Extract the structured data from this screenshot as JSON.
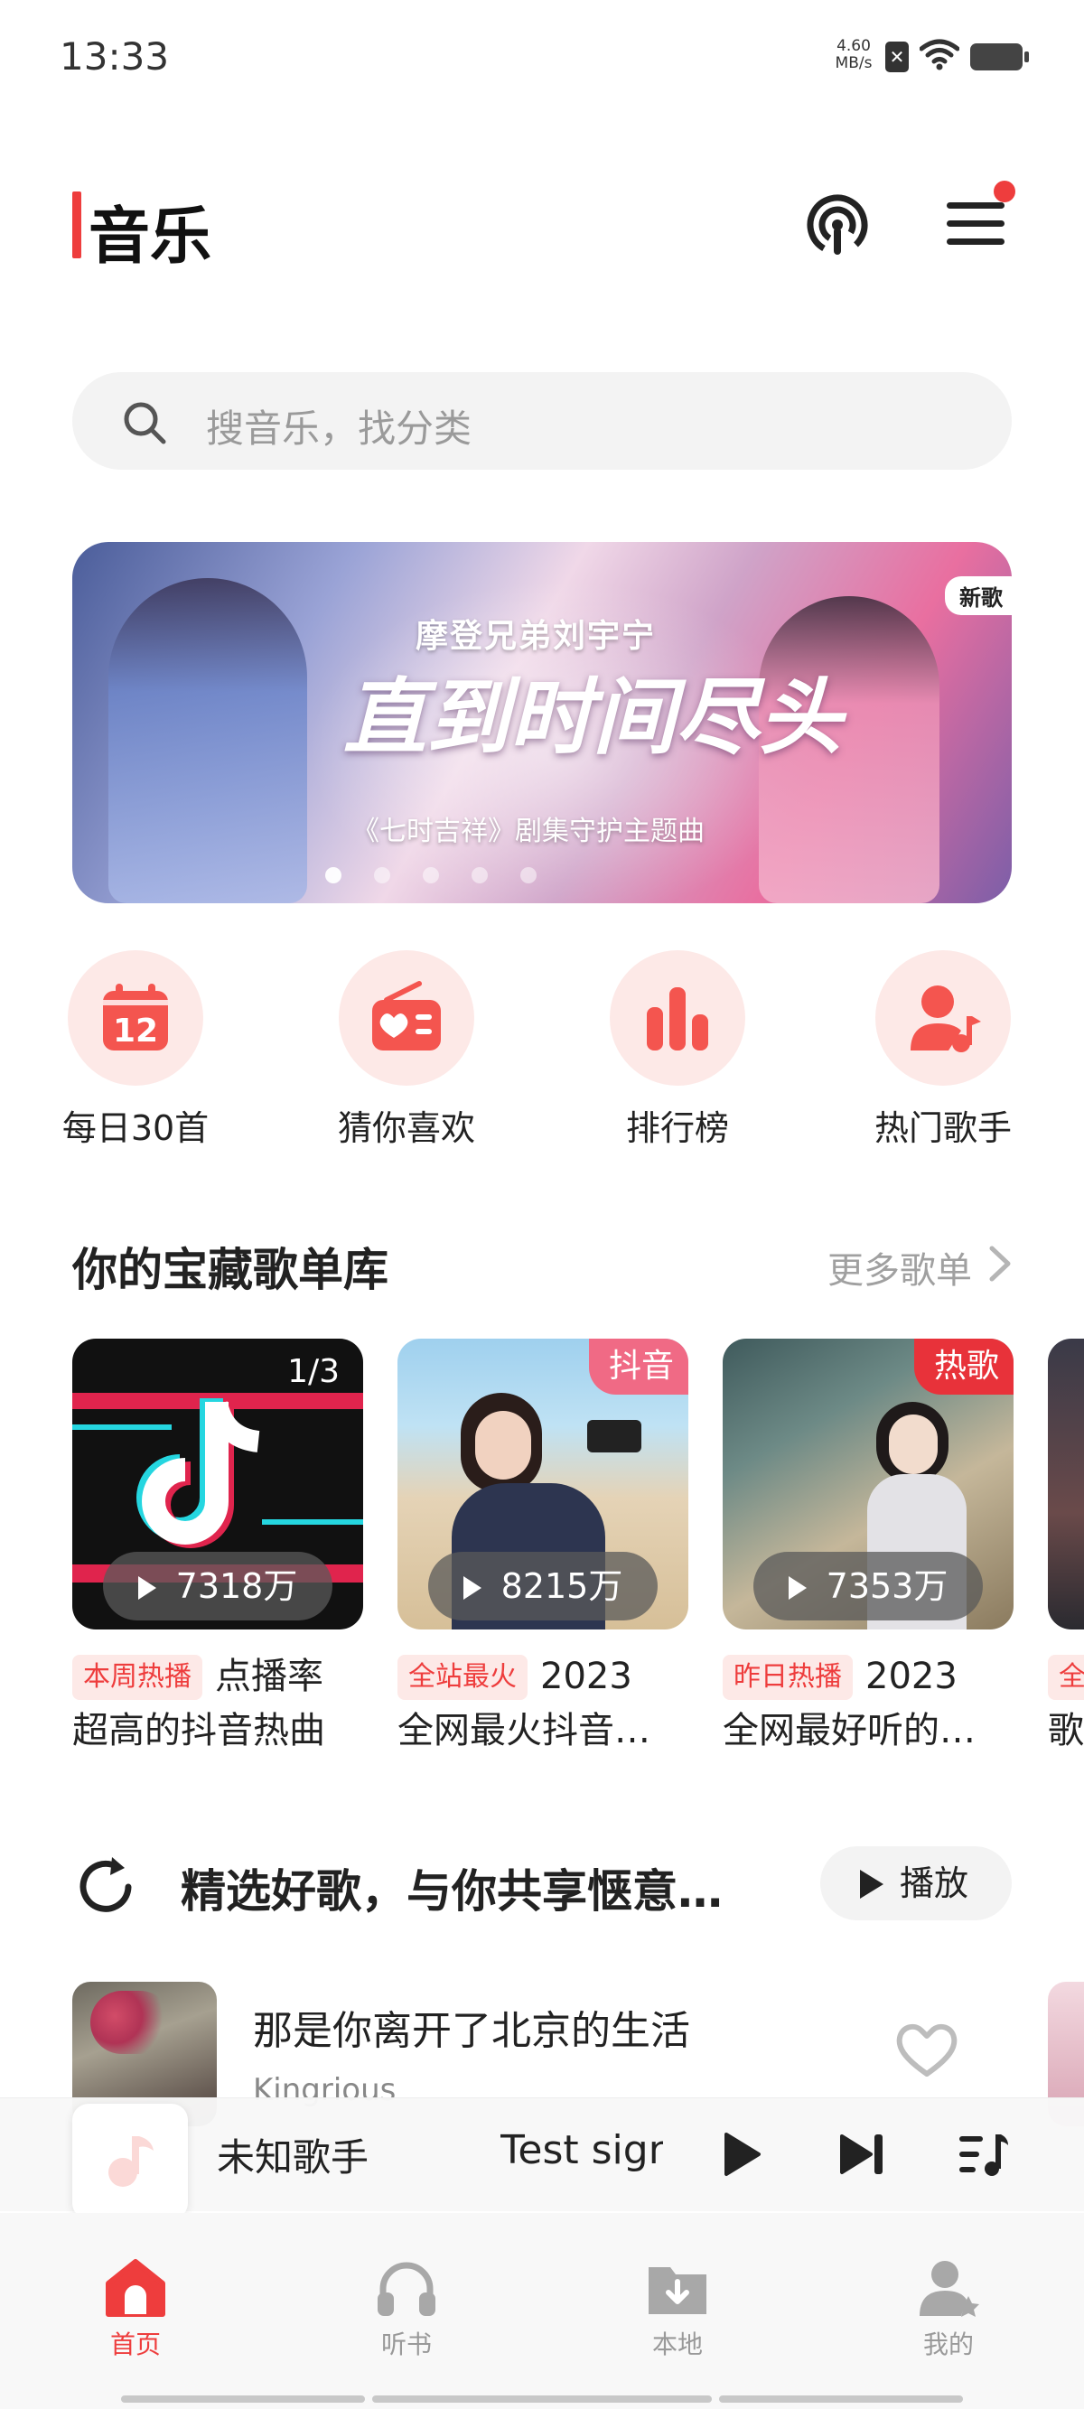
{
  "status_bar": {
    "time": "13:33",
    "net_speed_value": "4.60",
    "net_speed_unit": "MB/s"
  },
  "header": {
    "title": "音乐",
    "accent_color": "#ee3d3d"
  },
  "search": {
    "placeholder": "搜音乐，找分类"
  },
  "banner": {
    "subtitle": "摩登兄弟刘宇宁",
    "song_title": "直到时间尽头",
    "tagline": "《七时吉祥》剧集守护主题曲",
    "badge": "新歌",
    "page_count": 5,
    "active_page": 0
  },
  "quick_entries": [
    {
      "label": "每日30首",
      "icon": "calendar-icon"
    },
    {
      "label": "猜你喜欢",
      "icon": "radio-heart-icon"
    },
    {
      "label": "排行榜",
      "icon": "bar-chart-icon"
    },
    {
      "label": "热门歌手",
      "icon": "singer-icon"
    }
  ],
  "playlist_section": {
    "title": "你的宝藏歌单库",
    "more_label": "更多歌单",
    "playlists": [
      {
        "ratio": "1/3",
        "play_count": "7318万",
        "tag": "本周热播",
        "line1": "点播率",
        "line2": "超高的抖音热曲"
      },
      {
        "corner_tag": "抖音",
        "play_count": "8215万",
        "tag": "全站最火",
        "line1": "2023",
        "line2": "全网最火抖音…"
      },
      {
        "corner_tag": "热歌",
        "play_count": "7353万",
        "tag": "昨日热播",
        "line1": "2023",
        "line2": "全网最好听的…"
      },
      {
        "tag": "全",
        "line2": "歌"
      }
    ]
  },
  "featured": {
    "title": "精选好歌，与你共享惬意…",
    "play_label": "播放"
  },
  "songs": [
    {
      "title": "那是你离开了北京的生活",
      "artist": "Kingrious"
    }
  ],
  "mini_player": {
    "artist": "未知歌手",
    "track": "Test sign"
  },
  "bottom_nav": [
    {
      "label": "首页",
      "icon": "home-icon",
      "active": true
    },
    {
      "label": "听书",
      "icon": "headphones-icon",
      "active": false
    },
    {
      "label": "本地",
      "icon": "folder-download-icon",
      "active": false
    },
    {
      "label": "我的",
      "icon": "profile-icon",
      "active": false
    }
  ]
}
